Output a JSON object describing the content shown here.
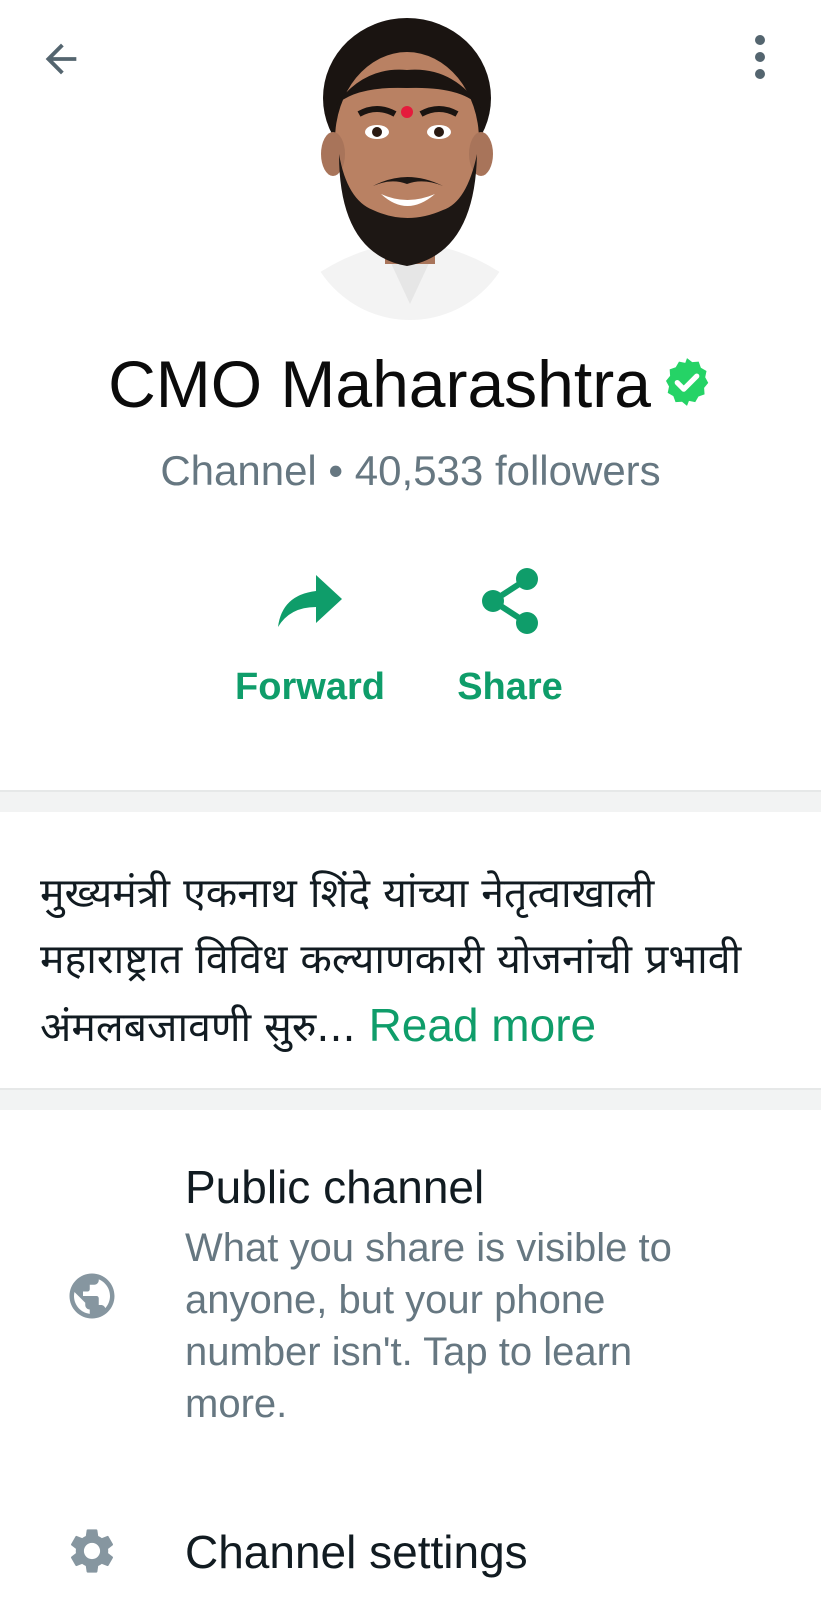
{
  "header": {
    "back_icon": "arrow-left-icon",
    "menu_icon": "more-vertical-icon"
  },
  "profile": {
    "name": "CMO Maharashtra",
    "verified_icon": "verified-badge-icon",
    "subtitle": "Channel • 40,533 followers"
  },
  "actions": [
    {
      "label": "Forward",
      "icon": "forward-arrow-icon"
    },
    {
      "label": "Share",
      "icon": "share-icon"
    }
  ],
  "description": {
    "text": "मुख्यमंत्री एकनाथ शिंदे यांच्या नेतृत्वाखाली महाराष्ट्रात विविध कल्याणकारी योजनांची प्रभावी अंमलबजावणी सुरु...",
    "read_more": "Read more"
  },
  "settings": [
    {
      "title": "Public channel",
      "subtitle": "What you share is visible to anyone, but your phone number isn't. Tap to learn more.",
      "icon": "globe-icon"
    },
    {
      "title": "Channel settings",
      "icon": "gear-icon"
    }
  ],
  "colors": {
    "accent": "#0f9d6a",
    "verified": "#25d366",
    "secondary_text": "#667781",
    "icon_gray": "#8696a0"
  }
}
